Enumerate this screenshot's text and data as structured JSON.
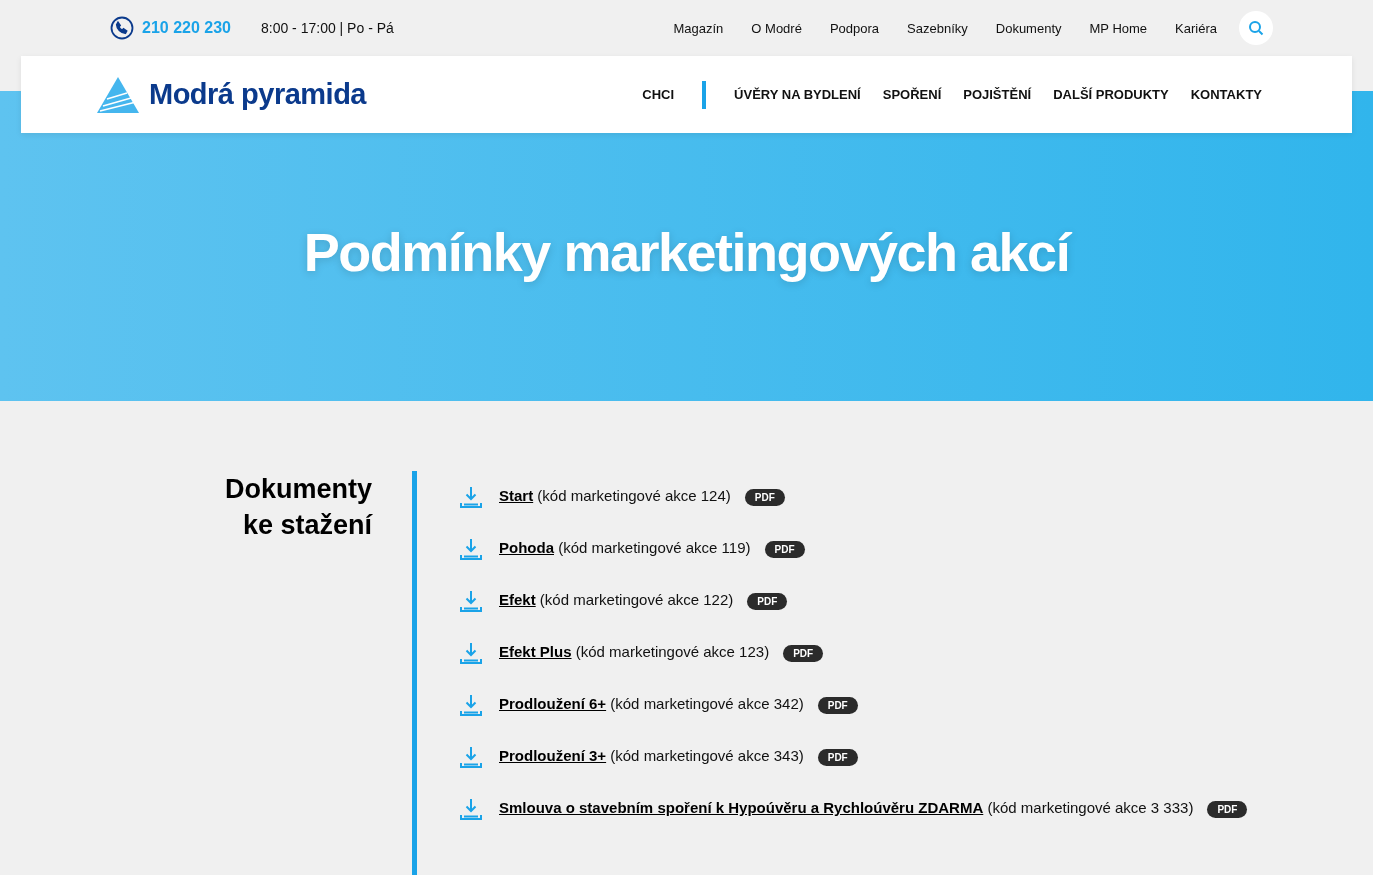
{
  "top_bar": {
    "phone": "210 220 230",
    "hours": "8:00 - 17:00 | Po - Pá",
    "links": [
      "Magazín",
      "O Modré",
      "Podpora",
      "Sazebníky",
      "Dokumenty",
      "MP Home",
      "Kariéra"
    ]
  },
  "header": {
    "logo_text": "Modrá pyramida",
    "nav": [
      {
        "label": "CHCI",
        "kind": "lead"
      },
      {
        "label": "ÚVĚRY NA BYDLENÍ",
        "kind": "item"
      },
      {
        "label": "SPOŘENÍ",
        "kind": "item"
      },
      {
        "label": "POJIŠTĚNÍ",
        "kind": "item"
      },
      {
        "label": "DALŠÍ PRODUKTY",
        "kind": "item"
      },
      {
        "label": "KONTAKTY",
        "kind": "item"
      }
    ]
  },
  "hero": {
    "title": "Podmínky marketingových akcí"
  },
  "section": {
    "heading_lines": [
      "Dokumenty",
      "ke stažení"
    ],
    "documents": [
      {
        "name": "Start",
        "note": "(kód marketingové akce 124)",
        "badge": "PDF"
      },
      {
        "name": "Pohoda",
        "note": "(kód marketingové akce 119)",
        "badge": "PDF"
      },
      {
        "name": "Efekt",
        "note": "(kód marketingové akce 122)",
        "badge": "PDF"
      },
      {
        "name": "Efekt Plus",
        "note": "(kód marketingové akce 123)",
        "badge": "PDF"
      },
      {
        "name": "Prodloužení 6+",
        "note": "(kód marketingové akce 342)",
        "badge": "PDF"
      },
      {
        "name": "Prodloužení 3+",
        "note": "(kód marketingové akce 343)",
        "badge": "PDF"
      },
      {
        "name": "Smlouva o stavebním spoření k Hypoúvěru a Rychloúvěru ZDARMA",
        "note": "(kód marketingové akce 3 333)",
        "badge": "PDF"
      }
    ]
  }
}
